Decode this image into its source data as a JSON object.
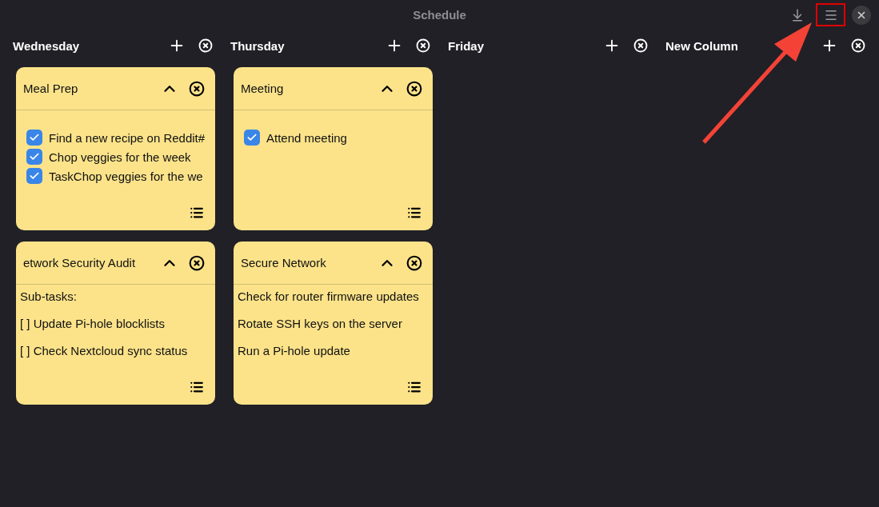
{
  "window": {
    "title": "Schedule"
  },
  "columns": [
    {
      "title": "Wednesday",
      "cards": [
        {
          "title": "Meal Prep",
          "kind": "checklist",
          "items": [
            {
              "text": "Find a new recipe on Reddit#",
              "checked": true
            },
            {
              "text": "Chop veggies for the week",
              "checked": true
            },
            {
              "text": "TaskChop veggies for the we",
              "checked": true
            }
          ]
        },
        {
          "title": "etwork Security Audit",
          "kind": "notes",
          "lines": [
            "Sub-tasks:",
            "[ ] Update Pi-hole blocklists",
            "[ ] Check Nextcloud sync status"
          ]
        }
      ]
    },
    {
      "title": "Thursday",
      "cards": [
        {
          "title": "Meeting",
          "kind": "checklist",
          "items": [
            {
              "text": "Attend meeting",
              "checked": true
            }
          ]
        },
        {
          "title": "Secure Network",
          "kind": "notes",
          "lines": [
            "Check for router firmware updates",
            "Rotate SSH keys on the server",
            "Run a Pi-hole update"
          ]
        }
      ]
    },
    {
      "title": "Friday"
    },
    {
      "title": "New Column"
    }
  ],
  "annotations": {
    "frame": true,
    "arrow": true
  }
}
